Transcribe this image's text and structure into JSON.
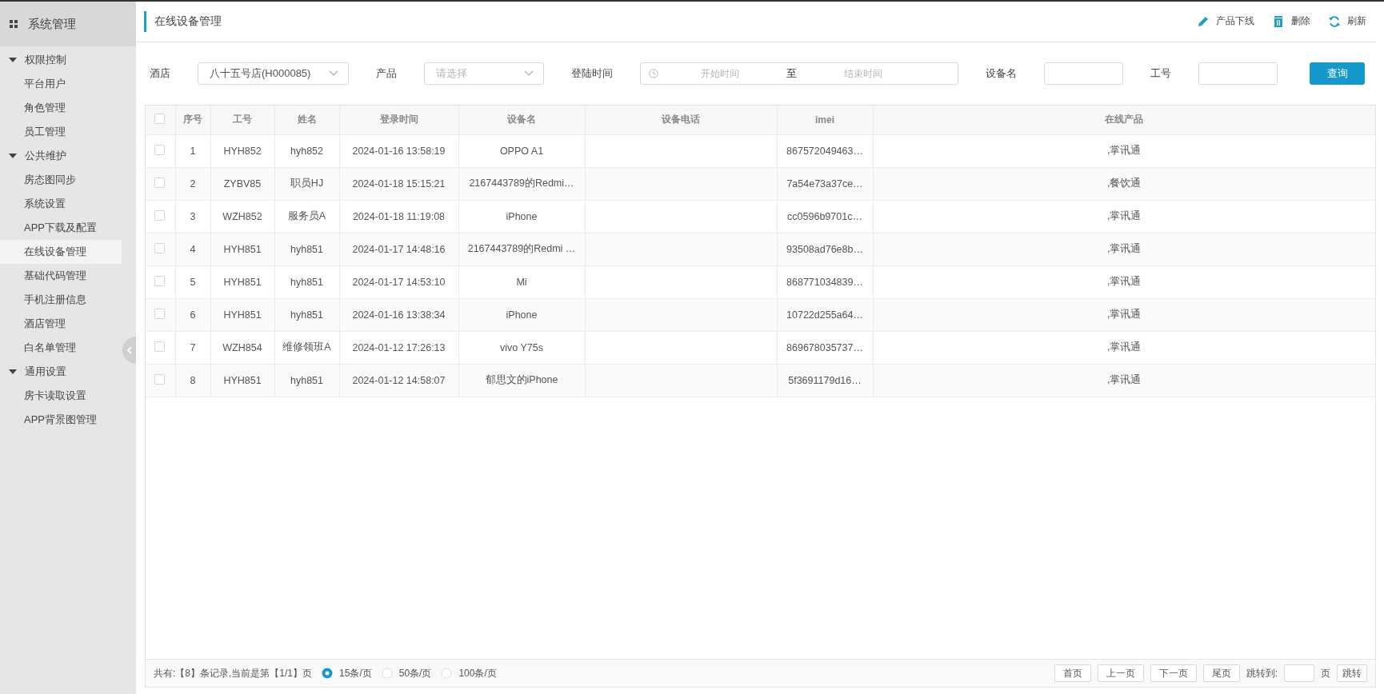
{
  "sidebar": {
    "title": "系统管理",
    "groups": [
      {
        "label": "权限控制",
        "expanded": true,
        "children": [
          {
            "label": "平台用户",
            "selected": false
          },
          {
            "label": "角色管理",
            "selected": false
          },
          {
            "label": "员工管理",
            "selected": false
          }
        ]
      },
      {
        "label": "公共维护",
        "expanded": true,
        "children": [
          {
            "label": "房态图同步",
            "selected": false
          },
          {
            "label": "系统设置",
            "selected": false
          },
          {
            "label": "APP下载及配置",
            "selected": false
          },
          {
            "label": "在线设备管理",
            "selected": true
          },
          {
            "label": "基础代码管理",
            "selected": false
          },
          {
            "label": "手机注册信息",
            "selected": false
          },
          {
            "label": "酒店管理",
            "selected": false
          },
          {
            "label": "白名单管理",
            "selected": false
          }
        ]
      },
      {
        "label": "通用设置",
        "expanded": true,
        "children": [
          {
            "label": "房卡读取设置",
            "selected": false
          },
          {
            "label": "APP背景图管理",
            "selected": false
          }
        ]
      }
    ]
  },
  "header": {
    "title": "在线设备管理",
    "actions": [
      {
        "label": "产品下线"
      },
      {
        "label": "删除"
      },
      {
        "label": "刷新"
      }
    ]
  },
  "filters": [
    {
      "kind": "select",
      "label": "酒店",
      "value": "八十五号店(H000085)"
    },
    {
      "kind": "select",
      "label": "产品",
      "placeholder": "请选择"
    },
    {
      "kind": "daterange",
      "label": "登陆时间",
      "start_placeholder": "开始时间",
      "separator": "至",
      "end_placeholder": "结束时间"
    },
    {
      "kind": "text",
      "label": "设备名"
    },
    {
      "kind": "text",
      "label": "工号"
    }
  ],
  "search_button": "查询",
  "table": {
    "header_checked": false,
    "columns": [
      "序号",
      "工号",
      "姓名",
      "登录时间",
      "设备名",
      "设备电话",
      "imei",
      "在线产品"
    ],
    "rows": [
      {
        "checked": false,
        "cells": [
          "1",
          "HYH852",
          "hyh852",
          "2024-01-16 13:58:19",
          "OPPO A1",
          "",
          "867572049463…",
          ",掌讯通"
        ]
      },
      {
        "checked": false,
        "cells": [
          "2",
          "ZYBV85",
          "职员HJ",
          "2024-01-18 15:15:21",
          "2167443789的Redmi…",
          "",
          "7a54e73a37ce…",
          ",餐饮通"
        ]
      },
      {
        "checked": false,
        "cells": [
          "3",
          "WZH852",
          "服务员A",
          "2024-01-18 11:19:08",
          "iPhone",
          "",
          "cc0596b9701c…",
          ",掌讯通"
        ]
      },
      {
        "checked": false,
        "cells": [
          "4",
          "HYH851",
          "hyh851",
          "2024-01-17 14:48:16",
          "2167443789的Redmi …",
          "",
          "93508ad76e8b…",
          ",掌讯通"
        ]
      },
      {
        "checked": false,
        "cells": [
          "5",
          "HYH851",
          "hyh851",
          "2024-01-17 14:53:10",
          "Mi",
          "",
          "868771034839…",
          ",掌讯通"
        ]
      },
      {
        "checked": false,
        "cells": [
          "6",
          "HYH851",
          "hyh851",
          "2024-01-16 13:38:34",
          "iPhone",
          "",
          "10722d255a64…",
          ",掌讯通"
        ]
      },
      {
        "checked": false,
        "cells": [
          "7",
          "WZH854",
          "维修领班A",
          "2024-01-12 17:26:13",
          "vivo Y75s",
          "",
          "869678035737…",
          ",掌讯通"
        ]
      },
      {
        "checked": false,
        "cells": [
          "8",
          "HYH851",
          "hyh851",
          "2024-01-12 14:58:07",
          "郁思文的iPhone",
          "",
          "5f3691179d16…",
          ",掌讯通"
        ]
      }
    ]
  },
  "pager": {
    "summary": "共有:【8】条记录,当前是第【1/1】页",
    "page_sizes": [
      {
        "label": "15条/页",
        "selected": true
      },
      {
        "label": "50条/页",
        "selected": false
      },
      {
        "label": "100条/页",
        "selected": false
      }
    ],
    "buttons": [
      "首页",
      "上一页",
      "下一页",
      "尾页"
    ],
    "jump_label": "跳转到:",
    "jump_unit": "页",
    "jump_button": "跳转"
  }
}
